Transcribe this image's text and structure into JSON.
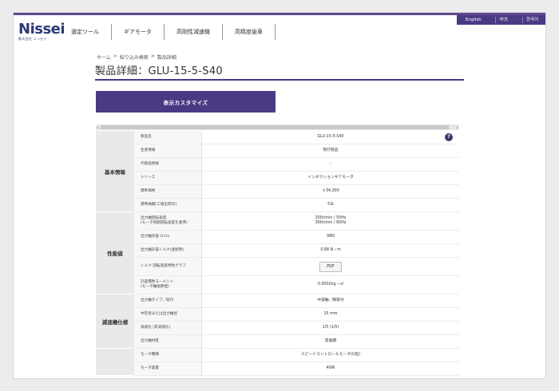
{
  "header": {
    "logo": "Nissei",
    "logo_sub": "株式会社 ニッセイ",
    "nav": [
      "選定ツール",
      "ギアモータ",
      "高剛性減速機",
      "高精度歯車"
    ],
    "languages": [
      "English",
      "中文",
      "한국어"
    ]
  },
  "breadcrumb": [
    "ホーム",
    ">",
    "絞り込み検索",
    ">",
    "製品詳細"
  ],
  "page_title": "製品詳細：GLU-15-5-S40",
  "customize_button": "表示カスタマイズ",
  "scroll": {
    "left_arrow": "◂",
    "right_arrow": "▸"
  },
  "help_icon": "?",
  "groups": [
    {
      "label": "基本情報",
      "rows": [
        {
          "field": "製品名",
          "value": "GLU-15-5-S40",
          "help": true
        },
        {
          "field": "生産情報",
          "value": "現行製品"
        },
        {
          "field": "代替品情報",
          "value": "-"
        },
        {
          "field": "シリーズ",
          "value": "インダクションギアモータ"
        },
        {
          "field": "標準価格",
          "value": "￥34,300"
        },
        {
          "field": "標準納期[工場出荷日]",
          "value": "5日"
        }
      ]
    },
    {
      "label": "性能値",
      "rows": [
        {
          "field": "出力軸回転速度\n(モータ同期回転速度を基準)",
          "value": "300r/min / 50Hz\n360r/min / 60Hz",
          "tall": true
        },
        {
          "field": "出力軸許容 O.H.L",
          "value": "98N"
        },
        {
          "field": "出力軸許容トルク(連続時)",
          "value": "0.88 N・m"
        },
        {
          "field": "トルク-回転速度特性グラフ",
          "value": "PDF",
          "button": true,
          "tall": true
        },
        {
          "field": "許容慣性モーメント\n(モータ軸換算値)",
          "value": "0.0002kg・㎡",
          "tall": true
        }
      ]
    },
    {
      "label": "減速機仕様",
      "rows": [
        {
          "field": "出力軸タイプ／取付",
          "value": "中実軸／脚取付"
        },
        {
          "field": "中空径または出力軸径",
          "value": "15 mm"
        },
        {
          "field": "減速比 (実減速比)",
          "value": "1/5 (1/5)"
        },
        {
          "field": "出力軸材質",
          "value": "炭素鋼"
        }
      ]
    },
    {
      "label": "",
      "rows": [
        {
          "field": "モータ種類",
          "value": "スピードコントロールモータ(U型)"
        },
        {
          "field": "モータ容量",
          "value": "40W"
        }
      ]
    }
  ]
}
